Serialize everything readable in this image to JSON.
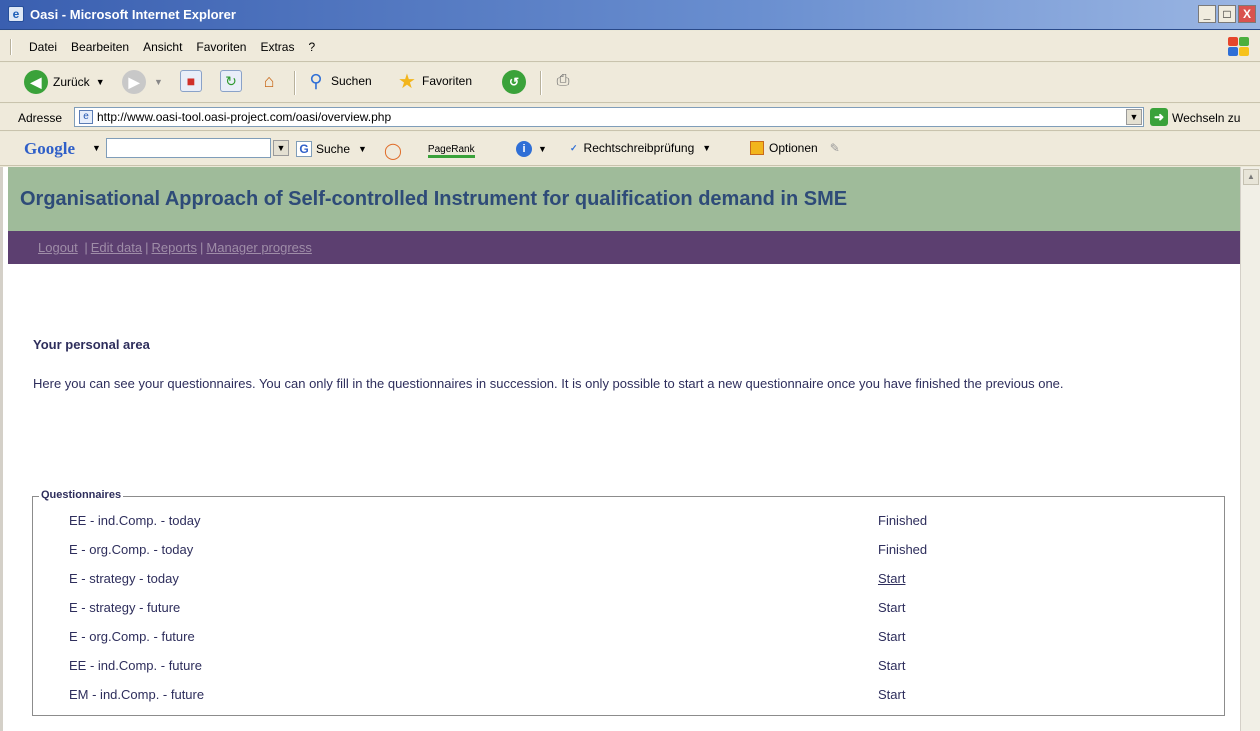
{
  "window": {
    "title": "Oasi - Microsoft Internet Explorer",
    "buttons": [
      "_",
      "□",
      "X"
    ]
  },
  "menubar": {
    "items": [
      "Datei",
      "Bearbeiten",
      "Ansicht",
      "Favoriten",
      "Extras",
      "?"
    ]
  },
  "toolbar": {
    "back_label": "Zurück",
    "search_label": "Suchen",
    "favorites_label": "Favoriten"
  },
  "address": {
    "label": "Adresse",
    "url": "http://www.oasi-tool.oasi-project.com/oasi/overview.php",
    "go_label": "Wechseln zu"
  },
  "googlebar": {
    "logo": "Google",
    "search_label": "Suche",
    "pagerank_label": "PageRank",
    "spellcheck_label": "Rechtschreibprüfung",
    "options_label": "Optionen"
  },
  "page": {
    "title": "Organisational Approach of Self-controlled Instrument for qualification demand in SME",
    "nav": {
      "logout": "Logout",
      "edit": "Edit data",
      "reports": "Reports",
      "manager": "Manager progress"
    },
    "heading": "Your personal area",
    "intro": "Here you can see your questionnaires. You can only fill in the questionnaires in succession. It is only possible to start a new questionnaire once you have finished the previous one.",
    "questionnaires_legend": "Questionnaires",
    "questionnaires": [
      {
        "name": "EE - ind.Comp. - today",
        "status": "Finished"
      },
      {
        "name": "E - org.Comp. - today",
        "status": "Finished"
      },
      {
        "name": "E - strategy - today",
        "status": "Start"
      },
      {
        "name": "E - strategy - future",
        "status": "Start"
      },
      {
        "name": "E - org.Comp. - future",
        "status": "Start"
      },
      {
        "name": "EE - ind.Comp. - future",
        "status": "Start"
      },
      {
        "name": "EM - ind.Comp. - future",
        "status": "Start"
      }
    ]
  },
  "colors": {
    "header_band": "#9fbb9a",
    "nav_band": "#5c3f70",
    "title_text": "#2e4b78",
    "body_text": "#2e2e5c"
  }
}
